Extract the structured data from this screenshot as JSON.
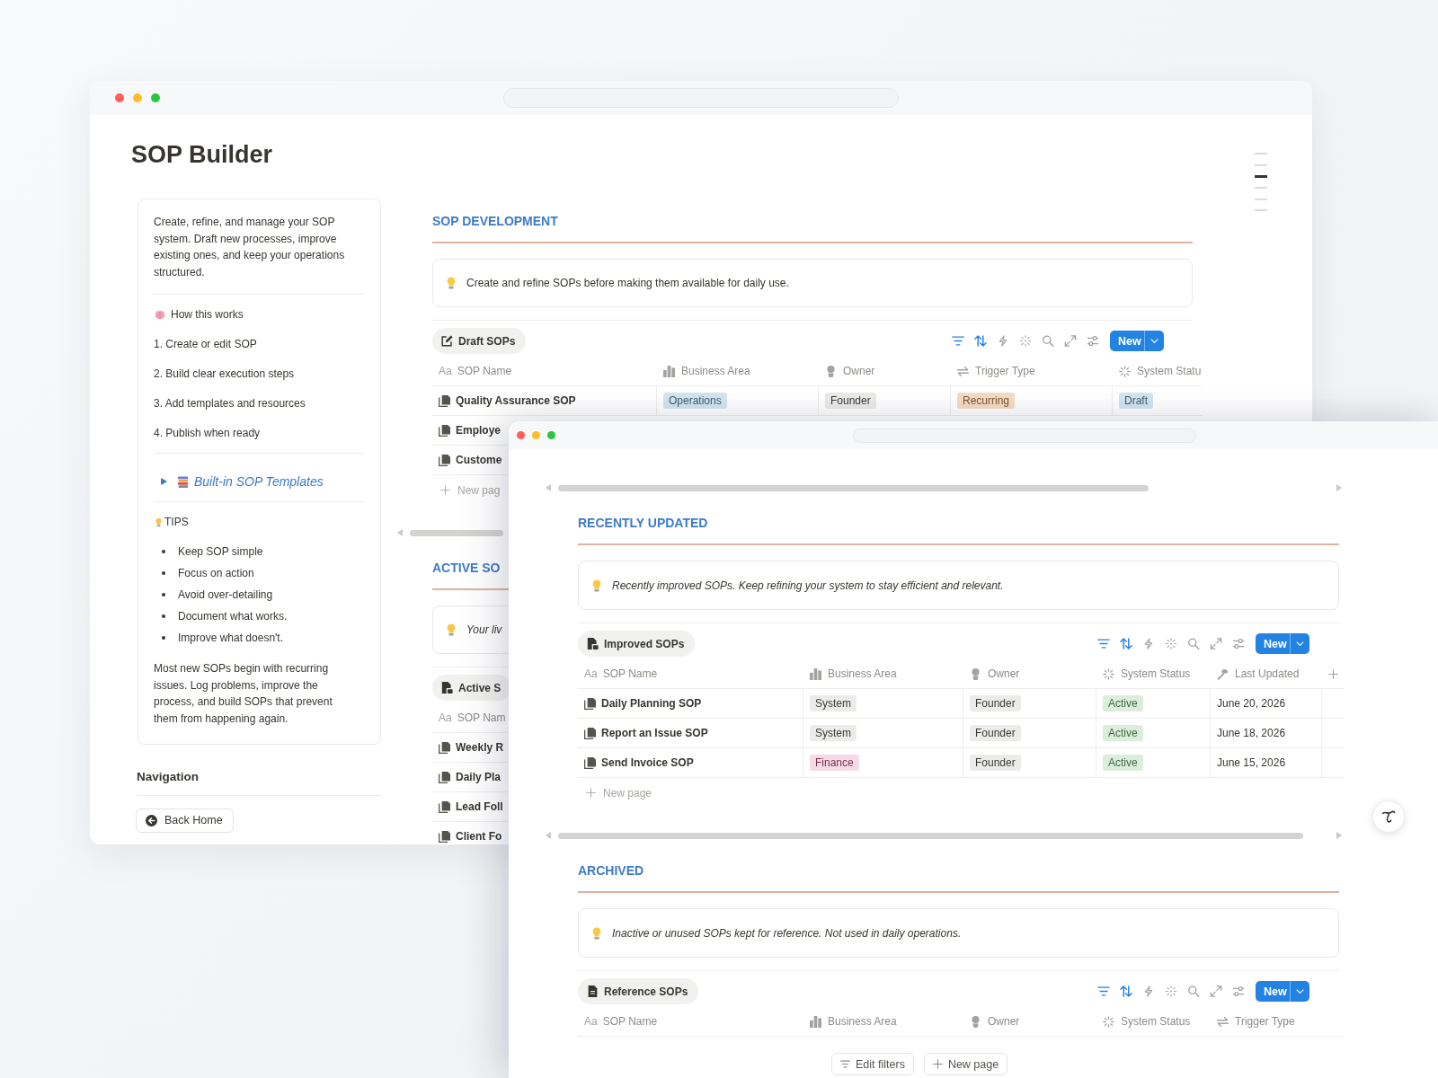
{
  "back_window": {
    "title": "SOP Builder",
    "outline": [
      {
        "selected": false
      },
      {
        "selected": false
      },
      {
        "selected": true
      },
      {
        "selected": false
      },
      {
        "selected": false
      },
      {
        "selected": false
      }
    ],
    "sidebar": {
      "intro": "Create, refine, and manage your SOP system. Draft new processes, improve existing ones, and keep your operations structured.",
      "how_heading": "How this works",
      "steps": [
        "1. Create or edit SOP",
        "2. Build clear execution steps",
        "3. Add templates and resources",
        "4. Publish when ready"
      ],
      "toggle": {
        "label": "Built-in SOP Templates",
        "expanded": false
      },
      "tips_heading": "TIPS",
      "tips": [
        "Keep SOP simple",
        "Focus on action",
        "Avoid over-detailing",
        "Document what works.",
        "Improve what doesn't."
      ],
      "closing": "Most new SOPs begin with recurring issues. Log problems, improve the process, and build SOPs that prevent them from happening again."
    },
    "navigation": {
      "heading": "Navigation",
      "buttons": [
        "Back Home"
      ]
    },
    "sections": [
      {
        "heading": "SOP DEVELOPMENT",
        "callout": "Create and refine SOPs before making them available for daily use.",
        "italic": false,
        "view_tab": "Draft SOPs",
        "toolbar": {
          "filter_active": true,
          "sort_active": true,
          "new_button": "New"
        },
        "columns": [
          {
            "label": "SOP Name",
            "kind": "title",
            "glyph": "Aa"
          },
          {
            "label": "Business Area",
            "kind": "area"
          },
          {
            "label": "Owner",
            "kind": "person"
          },
          {
            "label": "Trigger Type",
            "kind": "trigger"
          },
          {
            "label": "System Statu",
            "kind": "status"
          }
        ],
        "rows": [
          {
            "cells": [
              {
                "text": "Quality Assurance SOP"
              },
              {
                "text": "Operations",
                "color": "#d3e5ef"
              },
              {
                "text": "Founder",
                "color": "#ebebe9"
              },
              {
                "text": "Recurring",
                "color": "#f5dcc6"
              },
              {
                "text": "Draft",
                "color": "#d3e5ef"
              }
            ]
          },
          {
            "cells": [
              {
                "text": "Employe"
              }
            ]
          },
          {
            "cells": [
              {
                "text": "Custome"
              }
            ]
          }
        ],
        "new_row": "New pag"
      },
      {
        "heading": "ACTIVE SO",
        "callout": "Your liv",
        "italic": true,
        "view_tab": "Active S",
        "columns": [
          {
            "label": "SOP Nam",
            "kind": "title",
            "glyph": "Aa"
          }
        ],
        "rows": [
          {
            "cells": [
              {
                "text": "Weekly R"
              }
            ]
          },
          {
            "cells": [
              {
                "text": "Daily Pla"
              }
            ]
          },
          {
            "cells": [
              {
                "text": "Lead Foll"
              }
            ]
          },
          {
            "cells": [
              {
                "text": "Client Fo"
              }
            ]
          }
        ]
      }
    ]
  },
  "front_window": {
    "sections": [
      {
        "heading": "RECENTLY UPDATED",
        "callout": "Recently improved SOPs. Keep refining your system to stay efficient and relevant.",
        "italic": true,
        "view_tab": "Improved SOPs",
        "toolbar": {
          "filter_active": true,
          "sort_active": true,
          "new_button": "New"
        },
        "columns": [
          {
            "label": "SOP Name",
            "kind": "title",
            "glyph": "Aa"
          },
          {
            "label": "Business Area",
            "kind": "area"
          },
          {
            "label": "Owner",
            "kind": "person"
          },
          {
            "label": "System Status",
            "kind": "status"
          },
          {
            "label": "Last Updated",
            "kind": "date"
          }
        ],
        "add_column": true,
        "rows": [
          {
            "cells": [
              {
                "text": "Daily Planning SOP"
              },
              {
                "text": "System",
                "color": "#ebebe9"
              },
              {
                "text": "Founder",
                "color": "#ebebe9"
              },
              {
                "text": "Active",
                "color": "#dbeddb"
              },
              {
                "text": "June 20, 2026"
              }
            ]
          },
          {
            "cells": [
              {
                "text": "Report an Issue SOP"
              },
              {
                "text": "System",
                "color": "#ebebe9"
              },
              {
                "text": "Founder",
                "color": "#ebebe9"
              },
              {
                "text": "Active",
                "color": "#dbeddb"
              },
              {
                "text": "June 18, 2026"
              }
            ]
          },
          {
            "cells": [
              {
                "text": "Send Invoice SOP"
              },
              {
                "text": "Finance",
                "color": "#f5dbe6"
              },
              {
                "text": "Founder",
                "color": "#ebebe9"
              },
              {
                "text": "Active",
                "color": "#dbeddb"
              },
              {
                "text": "June 15, 2026"
              }
            ]
          }
        ],
        "new_row": "New page"
      },
      {
        "heading": "ARCHIVED",
        "callout": "Inactive or unused SOPs kept for reference. Not used in daily operations.",
        "italic": true,
        "view_tab": "Reference SOPs",
        "toolbar": {
          "filter_active": true,
          "sort_active": true,
          "new_button": "New"
        },
        "columns": [
          {
            "label": "SOP Name",
            "kind": "title",
            "glyph": "Aa"
          },
          {
            "label": "Business Area",
            "kind": "area"
          },
          {
            "label": "Owner",
            "kind": "person"
          },
          {
            "label": "System Status",
            "kind": "status"
          },
          {
            "label": "Trigger Type",
            "kind": "trigger"
          }
        ],
        "add_column": false,
        "footer_buttons": [
          {
            "label": "Edit filters",
            "kind": "filter"
          },
          {
            "label": "New page",
            "kind": "add"
          }
        ]
      }
    ]
  }
}
